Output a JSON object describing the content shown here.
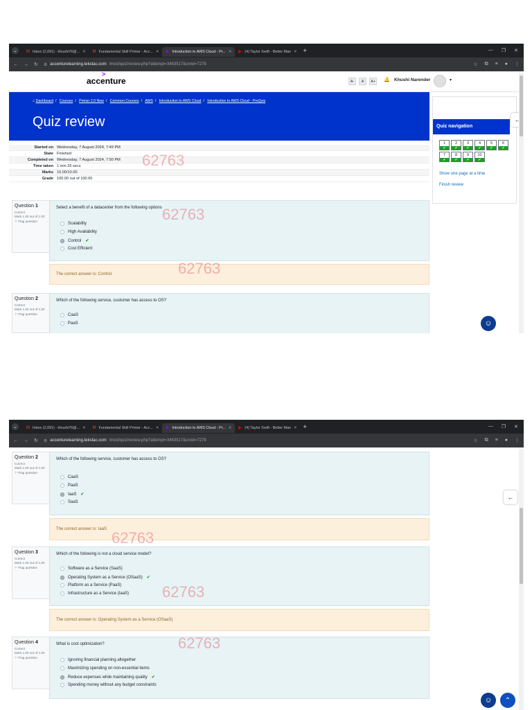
{
  "browser": {
    "tabs": [
      {
        "label": "Inbox (2,091) - khushi76@...",
        "icon": "gmail-icon",
        "active": false
      },
      {
        "label": "Fundamental Skill Primer - Acc...",
        "icon": "gmail-icon",
        "active": false
      },
      {
        "label": "Introduction to AWS Cloud - Pr...",
        "icon": "moodle-icon",
        "active": true
      },
      {
        "label": "(4) Taylor Swift - Better Man",
        "icon": "youtube-icon",
        "active": false
      }
    ],
    "url_host": "accenturelearning.tekstac.com",
    "url_path": "/mod/quiz/review.php?attempt=3463517&cmid=7278"
  },
  "header": {
    "logo": "accenture",
    "font_controls": [
      "A-",
      "A",
      "A+"
    ],
    "user_name": "Khushi Narender"
  },
  "breadcrumb": [
    "Dashboard",
    "Courses",
    "Primer 2.0 New",
    "Common Courses",
    "AWS",
    "Introduction to AWS Cloud",
    "Introduction to AWS Cloud - PreQuiz"
  ],
  "page_title": "Quiz review",
  "summary": [
    {
      "label": "Started on",
      "value": "Wednesday, 7 August 2024, 7:49 PM"
    },
    {
      "label": "State",
      "value": "Finished"
    },
    {
      "label": "Completed on",
      "value": "Wednesday, 7 August 2024, 7:50 PM"
    },
    {
      "label": "Time taken",
      "value": "1 min 26 secs"
    },
    {
      "label": "Marks",
      "value": "10.00/10.00"
    },
    {
      "label": "Grade",
      "value": "100.00 out of 100.00"
    }
  ],
  "quiz_nav": {
    "title": "Quiz navigation",
    "questions": [
      "1",
      "2",
      "3",
      "4",
      "5",
      "6",
      "7",
      "8",
      "9",
      "10"
    ],
    "show_one_page": "Show one page at a time",
    "finish_review": "Finish review"
  },
  "questions": [
    {
      "number": "1",
      "label_prefix": "Question",
      "state": "Correct",
      "mark": "Mark 1.00 out of 1.00",
      "flag": "Flag question",
      "text": "Select a benefit of a datacenter from the following options",
      "options": [
        "Scalability",
        "High Availability",
        "Control",
        "Cost Efficient"
      ],
      "selected": 2,
      "feedback": "The correct answer is: Control"
    },
    {
      "number": "2",
      "label_prefix": "Question",
      "state": "Correct",
      "mark": "Mark 1.00 out of 1.00",
      "flag": "Flag question",
      "text": "Which of the following service, customer has access to OS?",
      "options": [
        "CaaS",
        "PaaS",
        "IaaS",
        "SaaS"
      ],
      "selected": 2,
      "feedback": "The correct answer is: IaaS"
    },
    {
      "number": "3",
      "label_prefix": "Question",
      "state": "Correct",
      "mark": "Mark 1.00 out of 1.00",
      "flag": "Flag question",
      "text": "Which of the following is not a cloud service model?",
      "options": [
        "Software as a Service (SaaS)",
        "Operating System as a Service (OSaaS)",
        "Platform as a Service (PaaS)",
        "Infrastructure as a Service (IaaS)"
      ],
      "selected": 1,
      "feedback": "The correct answer is: Operating System as a Service (OSaaS)"
    },
    {
      "number": "4",
      "label_prefix": "Question",
      "state": "Correct",
      "mark": "Mark 1.00 out of 1.00",
      "flag": "Flag question",
      "text": "What is cost optimization?",
      "options": [
        "Ignoring financial planning altogether",
        "Maximizing spending on non-essential items",
        "Reduce expenses while maintaining quality",
        "Spending money without any budget constraints"
      ],
      "selected": 2
    }
  ],
  "watermark": "62763",
  "colors": {
    "brand_blue": "#0033cc",
    "correct_green": "#1f9d2a",
    "feedback_bg": "#fcefdc",
    "question_bg": "#e7f3f5"
  }
}
